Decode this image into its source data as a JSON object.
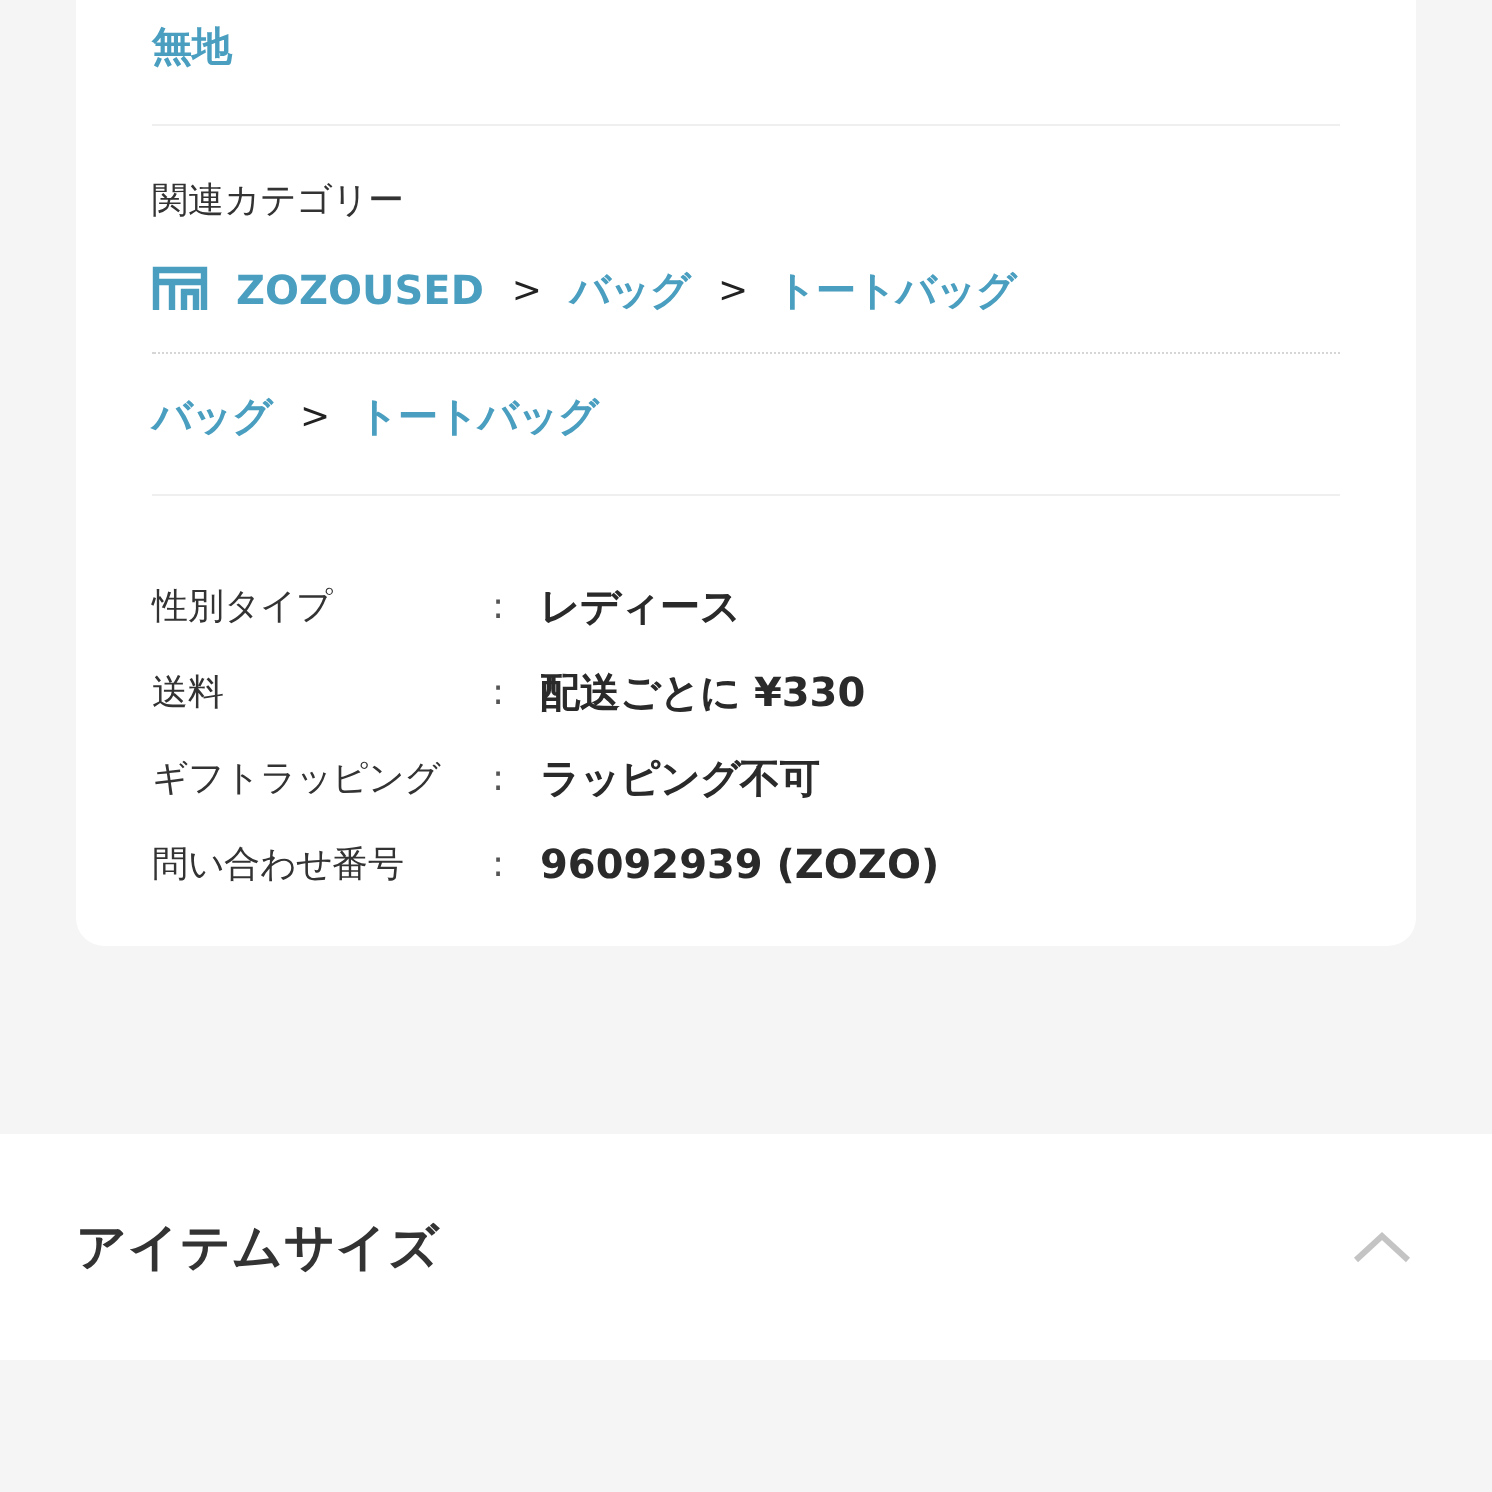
{
  "pattern_link": "無地",
  "related_categories": {
    "label": "関連カテゴリー",
    "paths": [
      {
        "kind": "shop",
        "items": [
          {
            "kind": "link",
            "text": "ZOZOUSED"
          },
          {
            "kind": "separator",
            "text": ">"
          },
          {
            "kind": "link",
            "text": "バッグ"
          },
          {
            "kind": "separator",
            "text": ">"
          },
          {
            "kind": "link",
            "text": "トートバッグ"
          }
        ]
      },
      {
        "kind": "plain",
        "items": [
          {
            "kind": "link",
            "text": "バッグ"
          },
          {
            "kind": "separator",
            "text": ">"
          },
          {
            "kind": "link",
            "text": "トートバッグ"
          }
        ]
      }
    ]
  },
  "specs": [
    {
      "label": "性別タイプ",
      "colon": ":",
      "value": "レディース"
    },
    {
      "label": "送料",
      "colon": ":",
      "value": "配送ごとに ¥330"
    },
    {
      "label": "ギフトラッピング",
      "colon": ":",
      "value": "ラッピング不可"
    },
    {
      "label": "問い合わせ番号",
      "colon": ":",
      "value": "96092939 (ZOZO)"
    }
  ],
  "section": {
    "title": "アイテムサイズ",
    "expanded": true
  }
}
